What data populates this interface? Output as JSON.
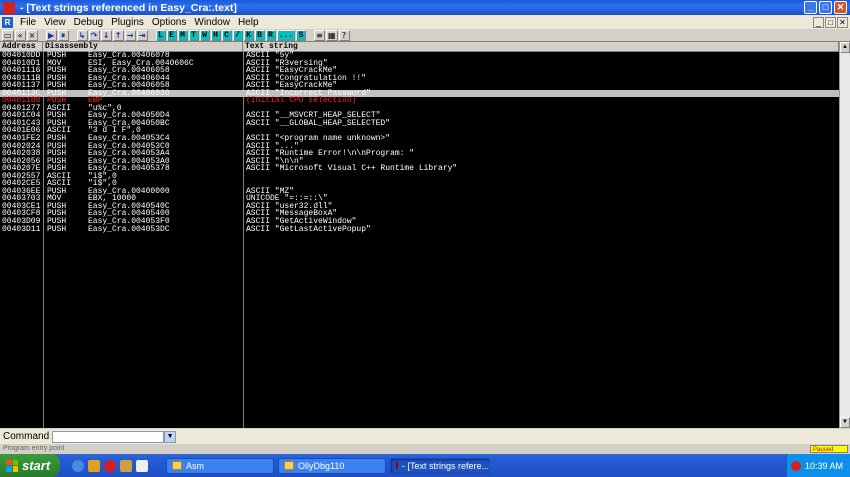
{
  "window": {
    "title": "- [Text strings referenced in Easy_Cra:.text]",
    "minimize": "_",
    "maximize": "□",
    "close": "✕"
  },
  "menu": {
    "items": [
      "File",
      "View",
      "Debug",
      "Plugins",
      "Options",
      "Window",
      "Help"
    ],
    "app_letter": "R"
  },
  "toolbar": {
    "buttons": [
      "▶",
      "⏸",
      "↳",
      "↷",
      "↓",
      "↑",
      "→",
      "⇥"
    ],
    "letters": [
      "L",
      "E",
      "M",
      "T",
      "W",
      "H",
      "C",
      "/",
      "K",
      "B",
      "R",
      "...",
      "S"
    ]
  },
  "columns": {
    "address": "Address",
    "disassembly": "Disassembly",
    "text": "Text string"
  },
  "rows": [
    {
      "addr": "004010DD",
      "op": "PUSH",
      "arg": "Easy_Cra.00406078",
      "text": "ASCII \"5y\""
    },
    {
      "addr": "004010D1",
      "op": "MOV",
      "arg": "ESI, Easy_Cra.0040606C",
      "text": "ASCII \"R3versing\""
    },
    {
      "addr": "00401116",
      "op": "PUSH",
      "arg": "Easy_Cra.00406058",
      "text": "ASCII \"EasyCrackMe\""
    },
    {
      "addr": "0040111B",
      "op": "PUSH",
      "arg": "Easy_Cra.00406044",
      "text": "ASCII \"Congratulation !!\""
    },
    {
      "addr": "00401137",
      "op": "PUSH",
      "arg": "Easy_Cra.00406058",
      "text": "ASCII \"EasyCrackMe\""
    },
    {
      "addr": "0040113C",
      "op": "PUSH",
      "arg": "Easy_Cra.00406030",
      "text": "ASCII \"Incorrect Password\"",
      "selected": true
    },
    {
      "addr": "00401188",
      "op": "PUSH",
      "arg": "EBP",
      "text": "(Initial CPU selection)",
      "red": true
    },
    {
      "addr": "00401277",
      "op": "ASCII",
      "arg": "\"u%c\",0",
      "text": ""
    },
    {
      "addr": "00401C04",
      "op": "PUSH",
      "arg": "Easy_Cra.004050D4",
      "text": "ASCII \"__MSVCRT_HEAP_SELECT\""
    },
    {
      "addr": "00401C43",
      "op": "PUSH",
      "arg": "Easy_Cra.004050BC",
      "text": "ASCII \"__GLOBAL_HEAP_SELECTED\""
    },
    {
      "addr": "00401E06",
      "op": "ASCII",
      "arg": "\"3 d I F\",0",
      "text": ""
    },
    {
      "addr": "00401FE2",
      "op": "PUSH",
      "arg": "Easy_Cra.004053C4",
      "text": "ASCII \"<program name unknown>\""
    },
    {
      "addr": "00402024",
      "op": "PUSH",
      "arg": "Easy_Cra.004053C0",
      "text": "ASCII \"...\""
    },
    {
      "addr": "00402038",
      "op": "PUSH",
      "arg": "Easy_Cra.004053A4",
      "text": "ASCII \"Runtime Error!\\n\\nProgram: \""
    },
    {
      "addr": "00402056",
      "op": "PUSH",
      "arg": "Easy_Cra.004053A0",
      "text": "ASCII \"\\n\\n\""
    },
    {
      "addr": "0040207E",
      "op": "PUSH",
      "arg": "Easy_Cra.00405378",
      "text": "ASCII \"Microsoft Visual C++ Runtime Library\""
    },
    {
      "addr": "00402557",
      "op": "ASCII",
      "arg": "\"i$\",0",
      "text": ""
    },
    {
      "addr": "00402CE5",
      "op": "ASCII",
      "arg": "\"i$\",0",
      "text": ""
    },
    {
      "addr": "004036EE",
      "op": "PUSH",
      "arg": "Easy_Cra.00400000",
      "text": "ASCII \"MZ\""
    },
    {
      "addr": "00403703",
      "op": "MOV",
      "arg": "EBX, 10000",
      "text": "UNICODE \"=::=::\\\""
    },
    {
      "addr": "00403CE1",
      "op": "PUSH",
      "arg": "Easy_Cra.0040540C",
      "text": "ASCII \"user32.dll\""
    },
    {
      "addr": "00403CF8",
      "op": "PUSH",
      "arg": "Easy_Cra.00405400",
      "text": "ASCII \"MessageBoxA\""
    },
    {
      "addr": "00403D09",
      "op": "PUSH",
      "arg": "Easy_Cra.004053F0",
      "text": "ASCII \"GetActiveWindow\""
    },
    {
      "addr": "00403D11",
      "op": "PUSH",
      "arg": "Easy_Cra.004053DC",
      "text": "ASCII \"GetLastActivePopup\""
    }
  ],
  "command": {
    "label": "Command",
    "value": ""
  },
  "status": {
    "text": "Program entry point",
    "state": "Paused"
  },
  "taskbar": {
    "start": "start",
    "tasks": [
      "Asm",
      "OllyDbg110",
      "- [Text strings refere..."
    ],
    "clock": "10:39 AM"
  },
  "colors": {
    "title_blue": "#2b6ff0",
    "selected_row": "#c0c0c0",
    "red_text": "#ff2020",
    "toolbar_letter_bg": "#00c0c0",
    "paused_bg": "#ffff00"
  }
}
